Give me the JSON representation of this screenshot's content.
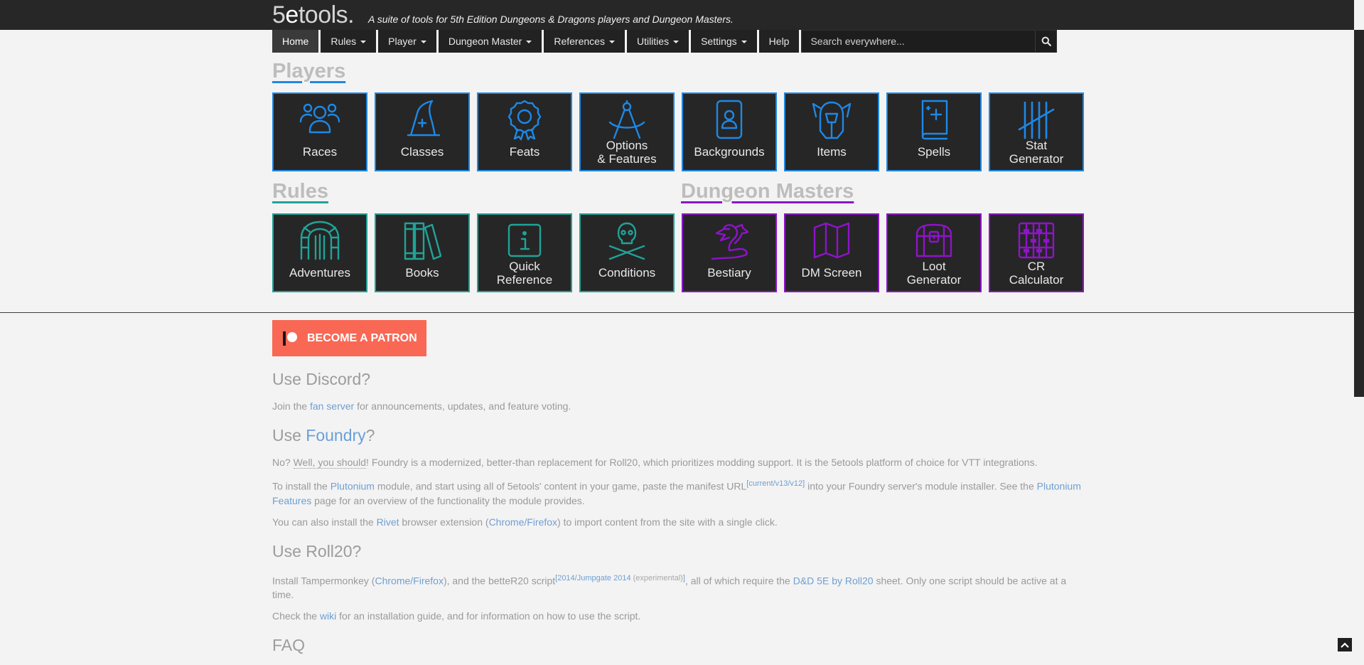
{
  "brand": {
    "logo_main": "5",
    "logo_e": "e",
    "logo_tools": "tools.",
    "tagline": "A suite of tools for 5th Edition Dungeons & Dragons players and Dungeon Masters."
  },
  "nav": {
    "home": "Home",
    "rules": "Rules",
    "player": "Player",
    "dm": "Dungeon Master",
    "references": "References",
    "utilities": "Utilities",
    "settings": "Settings",
    "help": "Help",
    "search_placeholder": "Search everywhere...",
    "search_icon": "search-icon"
  },
  "colors": {
    "players_accent": "#1e88e5",
    "rules_accent": "#20a398",
    "dm_accent": "#8e14c9",
    "patron": "#f96854",
    "link": "#6e9fd2"
  },
  "sections": {
    "players": "Players",
    "rules": "Rules",
    "dm": "Dungeon Masters"
  },
  "tiles": {
    "races": {
      "label": "Races",
      "icon": "people-icon"
    },
    "classes": {
      "label": "Classes",
      "icon": "wizard-hat-icon"
    },
    "feats": {
      "label": "Feats",
      "icon": "award-ribbon-icon"
    },
    "options": {
      "label": "Options\n& Features",
      "icon": "compass-icon"
    },
    "backgrounds": {
      "label": "Backgrounds",
      "icon": "id-badge-icon"
    },
    "items": {
      "label": "Items",
      "icon": "knight-helmet-icon"
    },
    "spells": {
      "label": "Spells",
      "icon": "spellbook-icon"
    },
    "stat": {
      "label": "Stat\nGenerator",
      "icon": "tally-marks-icon"
    },
    "adventures": {
      "label": "Adventures",
      "icon": "archway-icon"
    },
    "books": {
      "label": "Books",
      "icon": "books-icon"
    },
    "quickref": {
      "label": "Quick\nReference",
      "icon": "info-icon"
    },
    "conditions": {
      "label": "Conditions",
      "icon": "skull-crossbones-icon"
    },
    "bestiary": {
      "label": "Bestiary",
      "icon": "dragon-icon"
    },
    "dmscreen": {
      "label": "DM Screen",
      "icon": "map-icon"
    },
    "loot": {
      "label": "Loot\nGenerator",
      "icon": "treasure-chest-icon"
    },
    "cr": {
      "label": "CR\nCalculator",
      "icon": "abacus-icon"
    }
  },
  "patron": {
    "label": "BECOME A PATRON"
  },
  "discord": {
    "heading": "Use Discord?",
    "t1": "Join the ",
    "link": "fan server",
    "t2": " for announcements, updates, and feature voting."
  },
  "foundry": {
    "h1": "Use ",
    "h_link": "Foundry",
    "h2": "?",
    "p1_a": "No? ",
    "p1_dotted": "Well, you should",
    "p1_b": "! Foundry is a modernized, better-than replacement for Roll20, which prioritizes modding support. It is the 5etools platform of choice for VTT integrations.",
    "p2_a": "To install the ",
    "p2_link1": "Plutonium",
    "p2_b": " module, and start using all of 5etools' content in your game, paste the manifest URL",
    "p2_sup": "[current/v13/v12]",
    "p2_c": " into your Foundry server's module installer. See the ",
    "p2_link2": "Plutonium Features",
    "p2_d": " page for an overview of the functionality the module provides.",
    "p3_a": "You can also install the ",
    "p3_link1": "Rivet",
    "p3_b": " browser extension (",
    "p3_link2": "Chrome/Firefox",
    "p3_c": ") to import content from the site with a single click."
  },
  "roll20": {
    "heading": "Use Roll20?",
    "p1_a": "Install Tampermonkey (",
    "p1_link1": "Chrome/Firefox",
    "p1_b": "), and the betteR20 script",
    "p1_sup1": "[2014/Jumpgate 2014",
    "p1_sup_exp": " (experimental)",
    "p1_sup2": "]",
    "p1_c": ", all of which require the ",
    "p1_link2": "D&D 5E by Roll20",
    "p1_d": " sheet. Only one script should be active at a time.",
    "p2_a": "Check the ",
    "p2_link": "wiki",
    "p2_b": " for an installation guide, and for information on how to use the script."
  },
  "faq": {
    "heading": "FAQ"
  }
}
